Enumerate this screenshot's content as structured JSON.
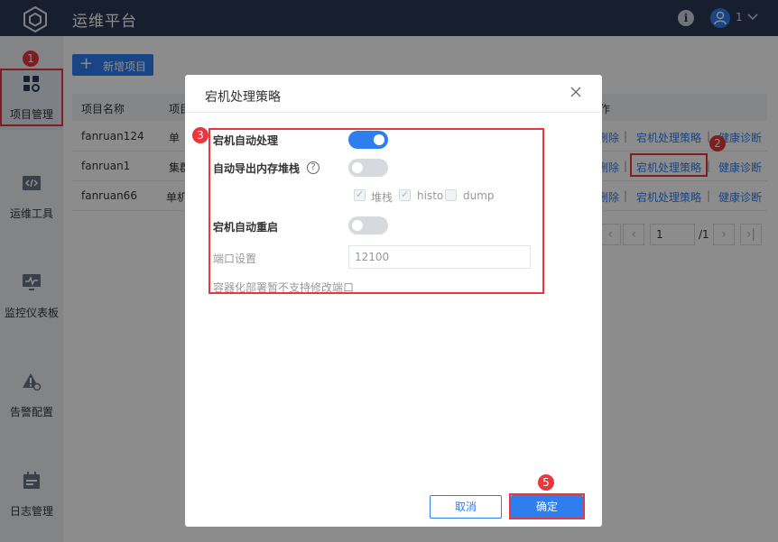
{
  "header": {
    "title": "运维平台",
    "user": "1",
    "info_icon": "info-icon",
    "avatar_icon": "user-avatar-icon"
  },
  "sidebar": {
    "items": [
      {
        "label": "项目管理",
        "icon": "grid-settings-icon",
        "active": true
      },
      {
        "label": "运维工具",
        "icon": "code-window-icon"
      },
      {
        "label": "监控仪表板",
        "icon": "monitor-pulse-icon"
      },
      {
        "label": "告警配置",
        "icon": "alert-settings-icon"
      },
      {
        "label": "日志管理",
        "icon": "calendar-log-icon"
      }
    ]
  },
  "toolbar": {
    "add_label": "新增项目"
  },
  "table": {
    "headers": [
      "项目名称",
      "项目",
      "作"
    ],
    "rows": [
      {
        "name": "fanruan124",
        "type": "单",
        "delete": "删除",
        "policy": "宕机处理策略",
        "diagnose": "健康诊断"
      },
      {
        "name": "fanruan1",
        "type": "集群",
        "delete": "删除",
        "policy": "宕机处理策略",
        "diagnose": "健康诊断"
      },
      {
        "name": "fanruan66",
        "type": "单机",
        "delete": "删除",
        "policy": "宕机处理策略",
        "diagnose": "健康诊断"
      }
    ],
    "separator": "|"
  },
  "pagination": {
    "current": "1",
    "total": "/1"
  },
  "modal": {
    "title": "宕机处理策略",
    "auto_handle_label": "宕机自动处理",
    "auto_handle_on": true,
    "auto_dump_label": "自动导出内存堆栈",
    "auto_dump_on": false,
    "help_mark": "?",
    "dump_options": [
      {
        "label": "堆栈",
        "checked": true
      },
      {
        "label": "histo",
        "checked": true
      },
      {
        "label": "dump",
        "checked": false
      }
    ],
    "auto_restart_label": "宕机自动重启",
    "auto_restart_on": false,
    "port_label": "端口设置",
    "port_value": "12100",
    "hint": "容器化部署暂不支持修改端口",
    "cancel_label": "取消",
    "ok_label": "确定"
  },
  "annotations": {
    "n1": "1",
    "n2": "2",
    "n3": "3",
    "n5": "5"
  },
  "colors": {
    "accent": "#2f7ef0",
    "topbar": "#2b3a55",
    "annotation": "#e8383d"
  }
}
